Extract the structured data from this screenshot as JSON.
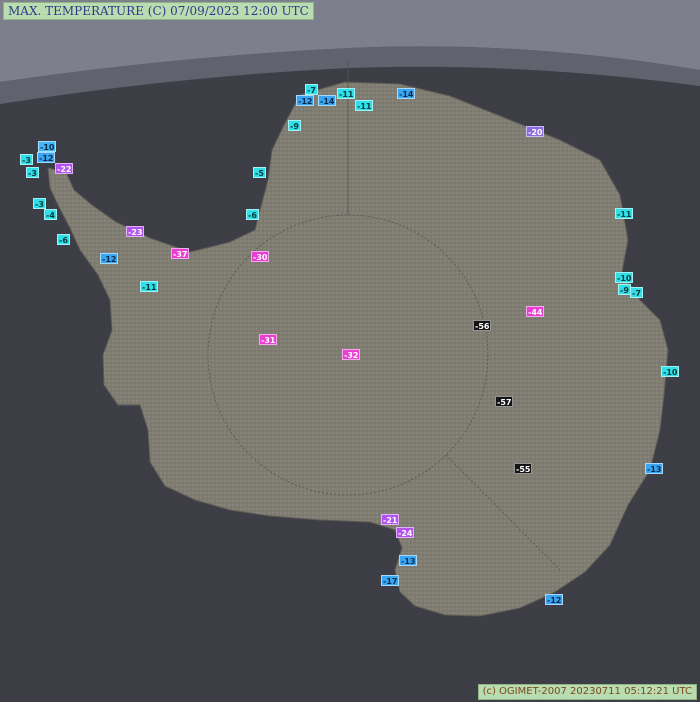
{
  "header": {
    "title": "MAX. TEMPERATURE (C)   07/09/2023 12:00 UTC"
  },
  "footer": {
    "copyright": "(c) OGIMET-2007 20230711 05:12:21 UTC"
  },
  "colors": {
    "background": "#3d3d46",
    "sky": "#7d7f8c",
    "land": "#7f7c72",
    "label_bg": "#b9dcb0",
    "temp_above_-15": "#2fe0e8",
    "temp_-15_to_-20": "#3aa6f2",
    "temp_-20_to_-30": "#b86bf0",
    "temp_-30_to_-50": "#f040d8",
    "temp_below_-50": "#1a1a1a"
  },
  "stations": [
    {
      "id": "s1",
      "value": "-10",
      "fg": "#0b2b4e",
      "bg": "#42b8f5"
    },
    {
      "id": "s2",
      "value": "-3",
      "fg": "#063a3c",
      "bg": "#2fe0e8"
    },
    {
      "id": "s3",
      "value": "-12",
      "fg": "#0b2b4e",
      "bg": "#3aa6f2"
    },
    {
      "id": "s4",
      "value": "-3",
      "fg": "#063a3c",
      "bg": "#2fe0e8"
    },
    {
      "id": "s5",
      "value": "-22",
      "fg": "#ffffff",
      "bg": "#b553f0"
    },
    {
      "id": "s6",
      "value": "-3",
      "fg": "#063a3c",
      "bg": "#2fe0e8"
    },
    {
      "id": "s7",
      "value": "-4",
      "fg": "#063a3c",
      "bg": "#2fe0e8"
    },
    {
      "id": "s8",
      "value": "-6",
      "fg": "#063a3c",
      "bg": "#2fe0e8"
    },
    {
      "id": "s9",
      "value": "-23",
      "fg": "#ffffff",
      "bg": "#b553f0"
    },
    {
      "id": "s10",
      "value": "-12",
      "fg": "#0b2b4e",
      "bg": "#3aa6f2"
    },
    {
      "id": "s11",
      "value": "-37",
      "fg": "#ffffff",
      "bg": "#e83fd2"
    },
    {
      "id": "s12",
      "value": "-11",
      "fg": "#063a3c",
      "bg": "#2fe0e8"
    },
    {
      "id": "s13",
      "value": "-30",
      "fg": "#ffffff",
      "bg": "#e83fd2"
    },
    {
      "id": "s14",
      "value": "-6",
      "fg": "#063a3c",
      "bg": "#2fe0e8"
    },
    {
      "id": "s15",
      "value": "-5",
      "fg": "#063a3c",
      "bg": "#2fe0e8"
    },
    {
      "id": "s16",
      "value": "-9",
      "fg": "#063a3c",
      "bg": "#2fe0e8"
    },
    {
      "id": "s17",
      "value": "-7",
      "fg": "#063a3c",
      "bg": "#2fe0e8"
    },
    {
      "id": "s18",
      "value": "-12",
      "fg": "#0b2b4e",
      "bg": "#3aa6f2"
    },
    {
      "id": "s19",
      "value": "-14",
      "fg": "#0b2b4e",
      "bg": "#3aa6f2"
    },
    {
      "id": "s20",
      "value": "-11",
      "fg": "#063a3c",
      "bg": "#2fe0e8"
    },
    {
      "id": "s21",
      "value": "-11",
      "fg": "#063a3c",
      "bg": "#2fe0e8"
    },
    {
      "id": "s22",
      "value": "-14",
      "fg": "#0b2b4e",
      "bg": "#3aa6f2"
    },
    {
      "id": "s23",
      "value": "-20",
      "fg": "#ffffff",
      "bg": "#8a6be0"
    },
    {
      "id": "s24",
      "value": "-11",
      "fg": "#063a3c",
      "bg": "#2fe0e8"
    },
    {
      "id": "s25",
      "value": "-10",
      "fg": "#063a3c",
      "bg": "#2fe0e8"
    },
    {
      "id": "s26",
      "value": "-9",
      "fg": "#063a3c",
      "bg": "#2fe0e8"
    },
    {
      "id": "s27",
      "value": "-7",
      "fg": "#063a3c",
      "bg": "#2fe0e8"
    },
    {
      "id": "s28",
      "value": "-56",
      "fg": "#ffffff",
      "bg": "#141414"
    },
    {
      "id": "s29",
      "value": "-44",
      "fg": "#ffffff",
      "bg": "#e83fd2"
    },
    {
      "id": "s30",
      "value": "-31",
      "fg": "#ffffff",
      "bg": "#e83fd2"
    },
    {
      "id": "s31",
      "value": "-32",
      "fg": "#ffffff",
      "bg": "#e83fd2"
    },
    {
      "id": "s32",
      "value": "-10",
      "fg": "#063a3c",
      "bg": "#2fe0e8"
    },
    {
      "id": "s33",
      "value": "-57",
      "fg": "#ffffff",
      "bg": "#141414"
    },
    {
      "id": "s34",
      "value": "-13",
      "fg": "#0b2b4e",
      "bg": "#3aa6f2"
    },
    {
      "id": "s35",
      "value": "-55",
      "fg": "#ffffff",
      "bg": "#141414"
    },
    {
      "id": "s36",
      "value": "-21",
      "fg": "#ffffff",
      "bg": "#b553f0"
    },
    {
      "id": "s37",
      "value": "-24",
      "fg": "#ffffff",
      "bg": "#b553f0"
    },
    {
      "id": "s38",
      "value": "-13",
      "fg": "#0b2b4e",
      "bg": "#3aa6f2"
    },
    {
      "id": "s39",
      "value": "-17",
      "fg": "#0b2b4e",
      "bg": "#3aa6f2"
    },
    {
      "id": "s40",
      "value": "-12",
      "fg": "#0b2b4e",
      "bg": "#3aa6f2"
    }
  ]
}
